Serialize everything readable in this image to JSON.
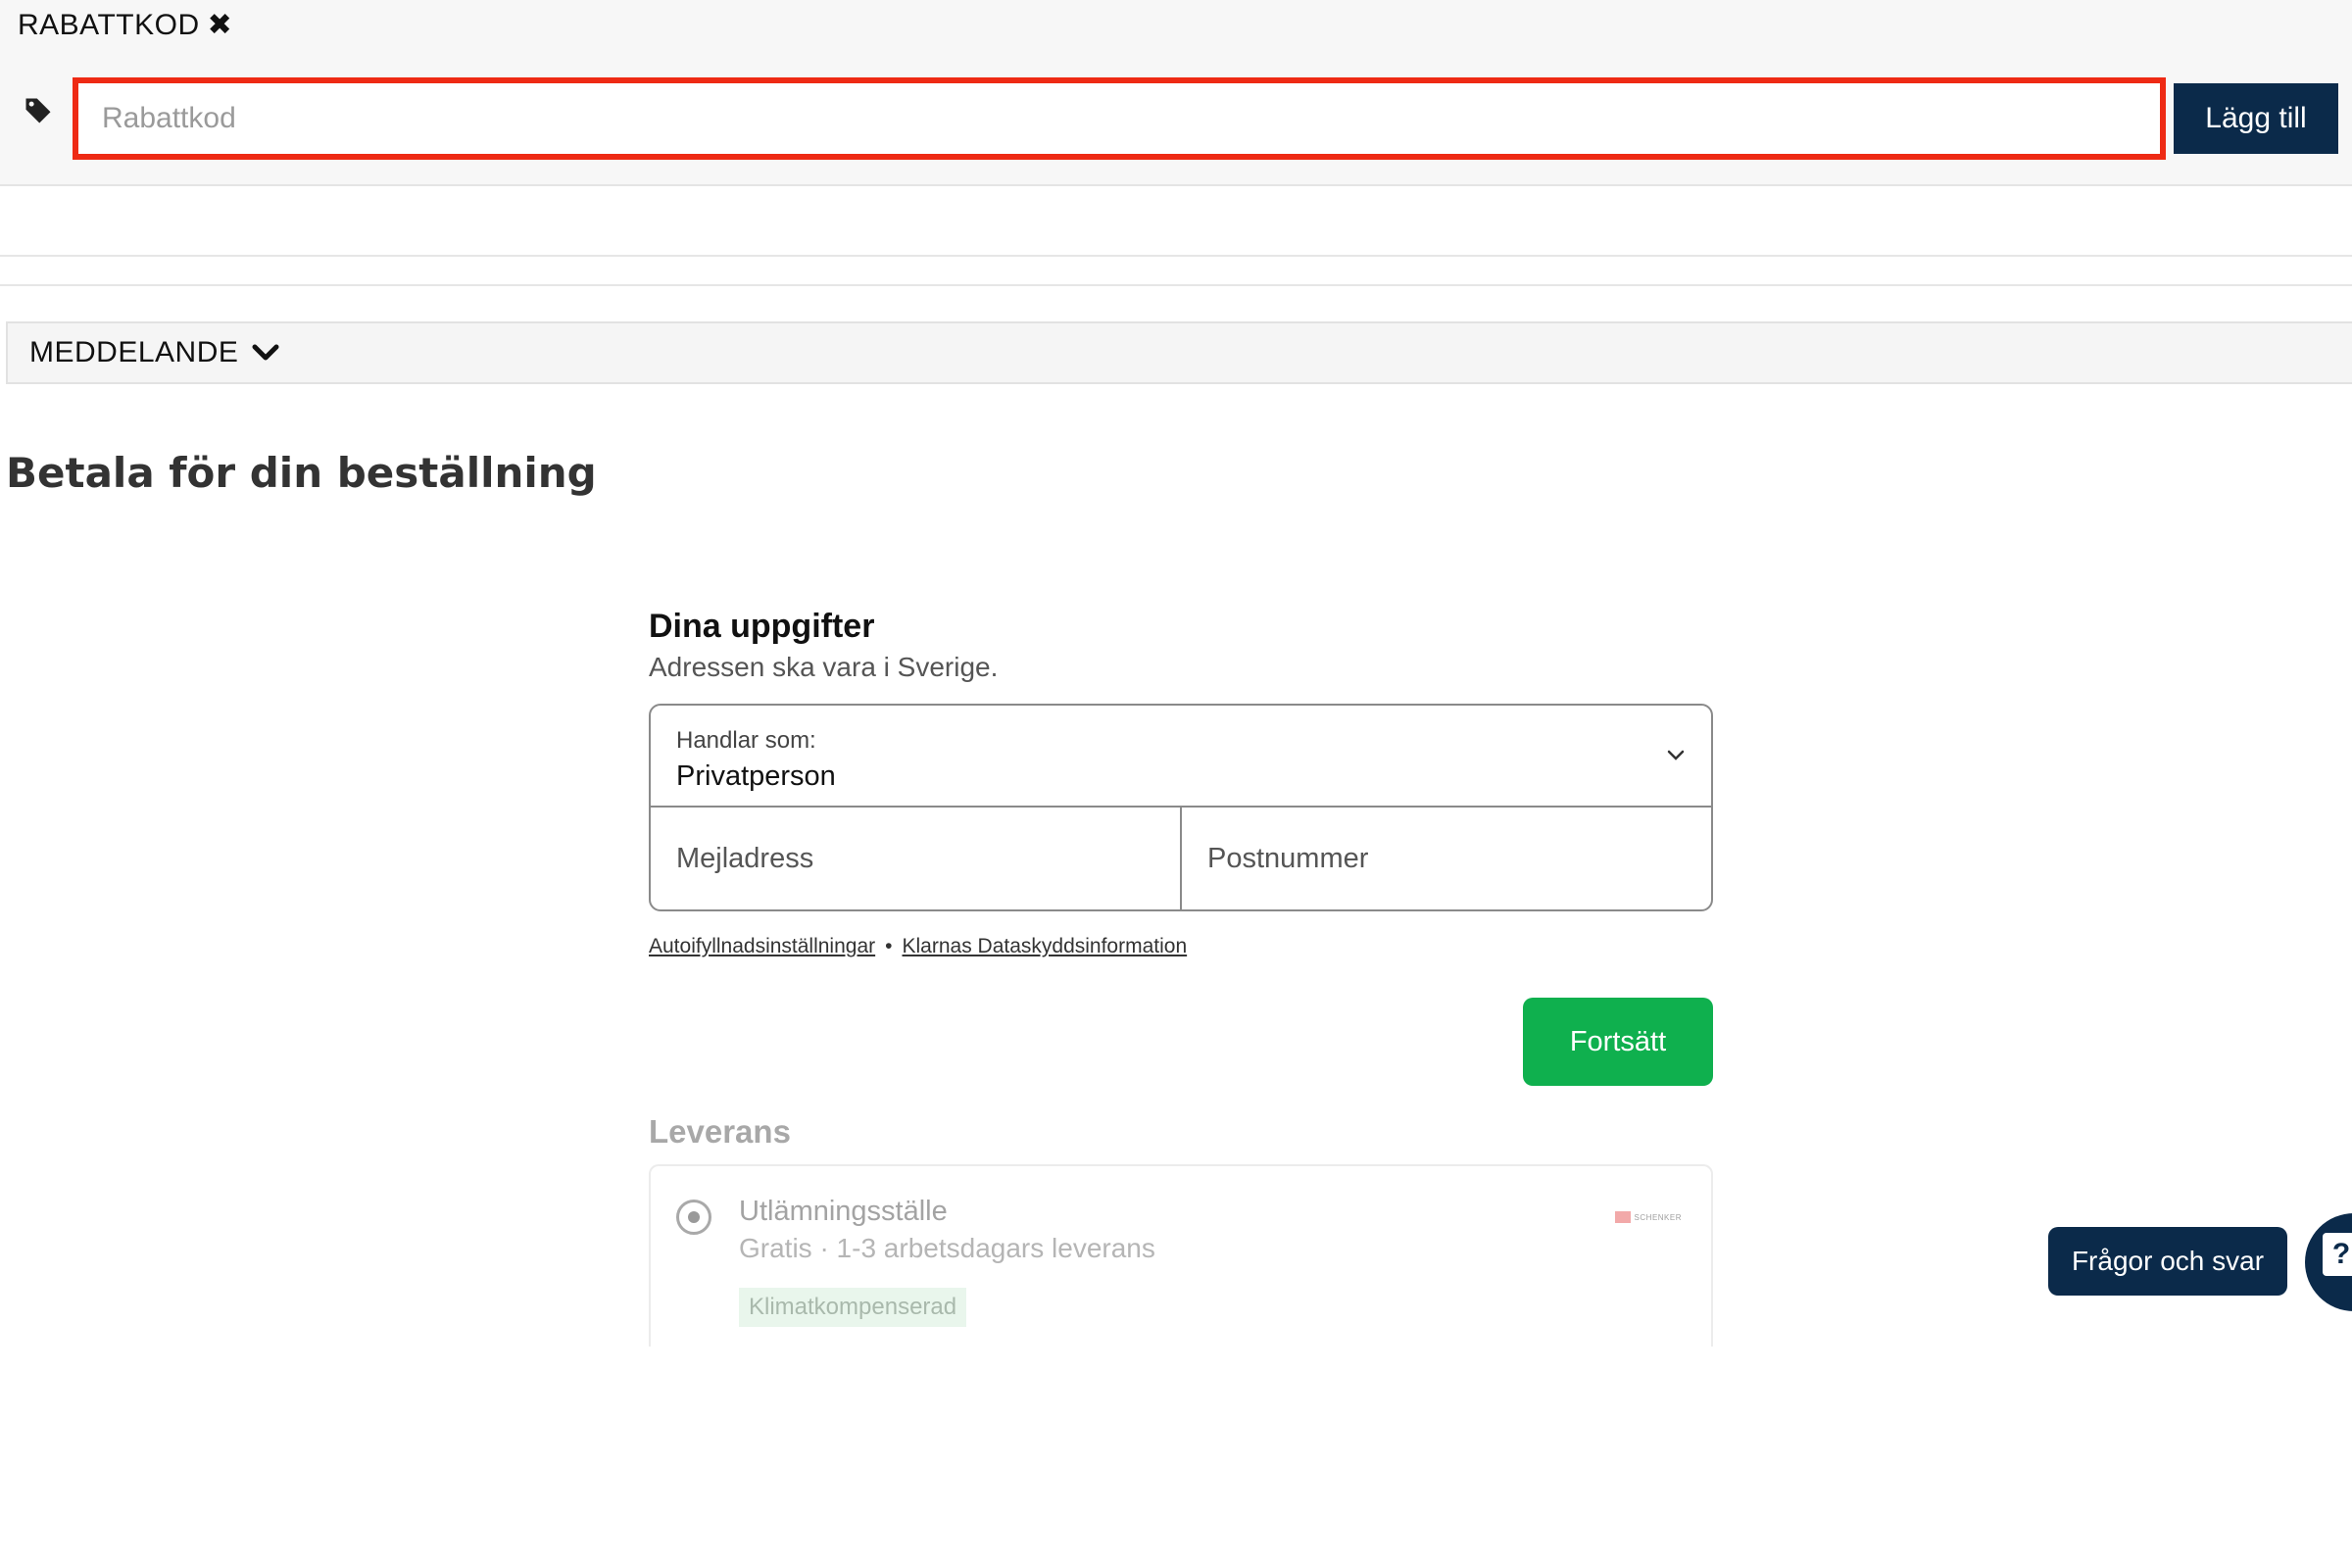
{
  "coupon": {
    "header": "RABATTKOD",
    "close_icon": "✖",
    "placeholder": "Rabattkod",
    "value": "",
    "add_label": "Lägg till"
  },
  "message": {
    "label": "MEDDELANDE"
  },
  "page": {
    "title": "Betala för din beställning"
  },
  "klarna": {
    "title": "Dina uppgifter",
    "subtitle": "Adressen ska vara i Sverige.",
    "customer_type": {
      "label": "Handlar som:",
      "value": "Privatperson"
    },
    "email_placeholder": "Mejladress",
    "zip_placeholder": "Postnummer",
    "links": {
      "autofill": "Autoifyllnadsinställningar",
      "separator": "•",
      "privacy": "Klarnas Dataskyddsinformation"
    },
    "continue_label": "Fortsätt",
    "delivery": {
      "title": "Leverans",
      "option_title": "Utlämningsställe",
      "option_sub": "Gratis · 1-3 arbetsdagars leverans",
      "badge": "Klimatkompenserad",
      "carrier": "SCHENKER"
    }
  },
  "support": {
    "faq_label": "Frågor och svar",
    "chat_glyph": "?"
  },
  "colors": {
    "highlight": "#ee2a14",
    "navy": "#0b2a4a",
    "green": "#0fb04e"
  }
}
